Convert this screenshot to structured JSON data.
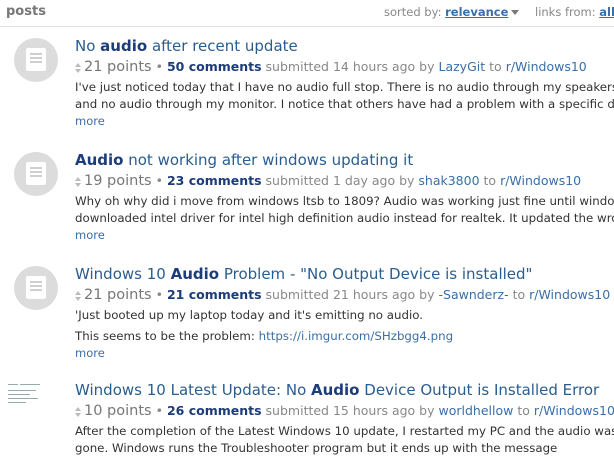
{
  "header": {
    "posts_label": "posts",
    "sorted_by_label": "sorted by:",
    "sorted_by_value": "relevance",
    "links_from_label": "links from:",
    "links_from_value": "all t"
  },
  "results": [
    {
      "title_pre": "No ",
      "title_match": "audio",
      "title_post": " after recent update",
      "points": "21 points",
      "comments": "50 comments",
      "submitted": "submitted 14 hours ago by",
      "author": "LazyGit",
      "to": "to",
      "subreddit": "r/Windows10",
      "snippet_1": "I've just noticed today that I have no audio full stop. There is no audio through my speakers",
      "snippet_2": "and no audio through my monitor. I notice that others have had a problem with a specific devic",
      "snippet_3": "",
      "more": "more"
    },
    {
      "title_pre": "",
      "title_match": "Audio",
      "title_post": " not working after windows updating it",
      "points": "19 points",
      "comments": "23 comments",
      "submitted": "submitted 1 day ago by",
      "author": "shak3800",
      "to": "to",
      "subreddit": "r/Windows10",
      "snippet_1": "Why oh why did i move from windows ltsb to 1809? Audio was working just fine until windows",
      "snippet_2": "downloaded intel driver for intel high definition audio instead for realtek. It updated the wrong",
      "snippet_3": "",
      "more": "more"
    },
    {
      "title_pre": "Windows 10 ",
      "title_match": "Audio",
      "title_post": " Problem - \"No Output Device is installed\"",
      "points": "21 points",
      "comments": "21 comments",
      "submitted": "submitted 21 hours ago by",
      "author": "-Sawnderz-",
      "to": "to",
      "subreddit": "r/Windows10",
      "snippet_1": "'Just booted up my laptop today and it's emitting no audio.",
      "snippet_2_text": "This seems to be the problem: ",
      "snippet_2_link": "https://i.imgur.com/SHzbgg4.png",
      "more": "more"
    },
    {
      "title_pre": "Windows 10 Latest Update: No ",
      "title_match": "Audio",
      "title_post": " Device Output is Installed Error",
      "points": "10 points",
      "comments": "26 comments",
      "submitted": "submitted 15 hours ago by",
      "author": "worldhellow",
      "to": "to",
      "subreddit": "r/Windows10",
      "snippet_1": "After the completion of the Latest Windows 10 update, I restarted my PC and the audio was",
      "snippet_2": "gone. Windows runs the Troubleshooter program but it ends up with the message"
    }
  ]
}
